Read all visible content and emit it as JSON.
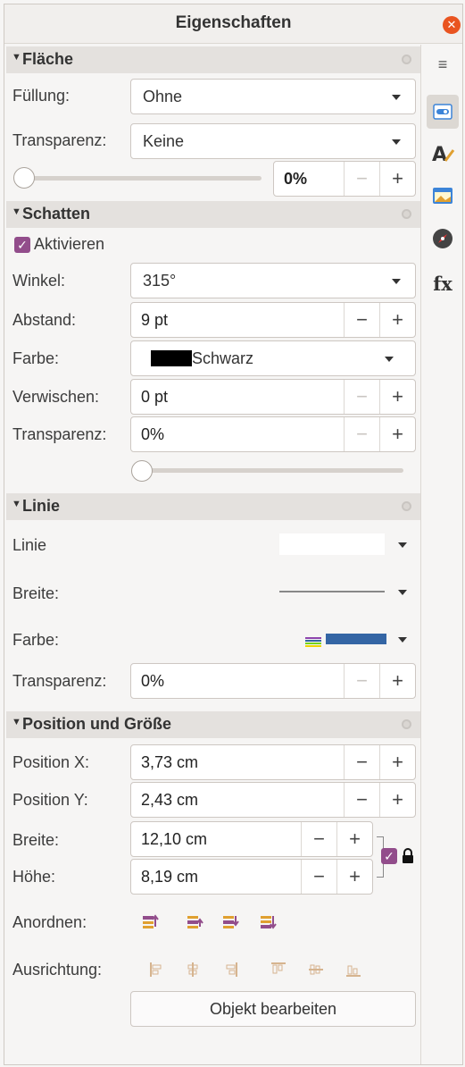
{
  "window": {
    "title": "Eigenschaften"
  },
  "flaeche": {
    "header": "Fläche",
    "fill_label": "Füllung:",
    "fill_value": "Ohne",
    "transparency_label": "Transparenz:",
    "transparency_value": "Keine",
    "transparency_percent": "0%"
  },
  "schatten": {
    "header": "Schatten",
    "enable_label": "Aktivieren",
    "angle_label": "Winkel:",
    "angle_value": "315°",
    "distance_label": "Abstand:",
    "distance_value": "9 pt",
    "color_label": "Farbe:",
    "color_value": "Schwarz",
    "color_hex": "#000000",
    "blur_label": "Verwischen:",
    "blur_value": "0 pt",
    "transparency_label": "Transparenz:",
    "transparency_value": "0%"
  },
  "linie": {
    "header": "Linie",
    "line_label": "Linie",
    "width_label": "Breite:",
    "color_label": "Farbe:",
    "color_hex": "#3465a4",
    "transparency_label": "Transparenz:",
    "transparency_value": "0%"
  },
  "position": {
    "header": "Position und Größe",
    "pos_x_label": "Position X:",
    "pos_x_value": "3,73 cm",
    "pos_y_label": "Position Y:",
    "pos_y_value": "2,43 cm",
    "width_label": "Breite:",
    "width_value": "12,10 cm",
    "height_label": "Höhe:",
    "height_value": "8,19 cm",
    "arrange_label": "Anordnen:",
    "align_label": "Ausrichtung:",
    "edit_object_button": "Objekt bearbeiten"
  },
  "controls": {
    "minus": "−",
    "plus": "+"
  },
  "colors": {
    "accent": "#924d8b",
    "close": "#e95420",
    "header_bg": "#e4e1de"
  }
}
